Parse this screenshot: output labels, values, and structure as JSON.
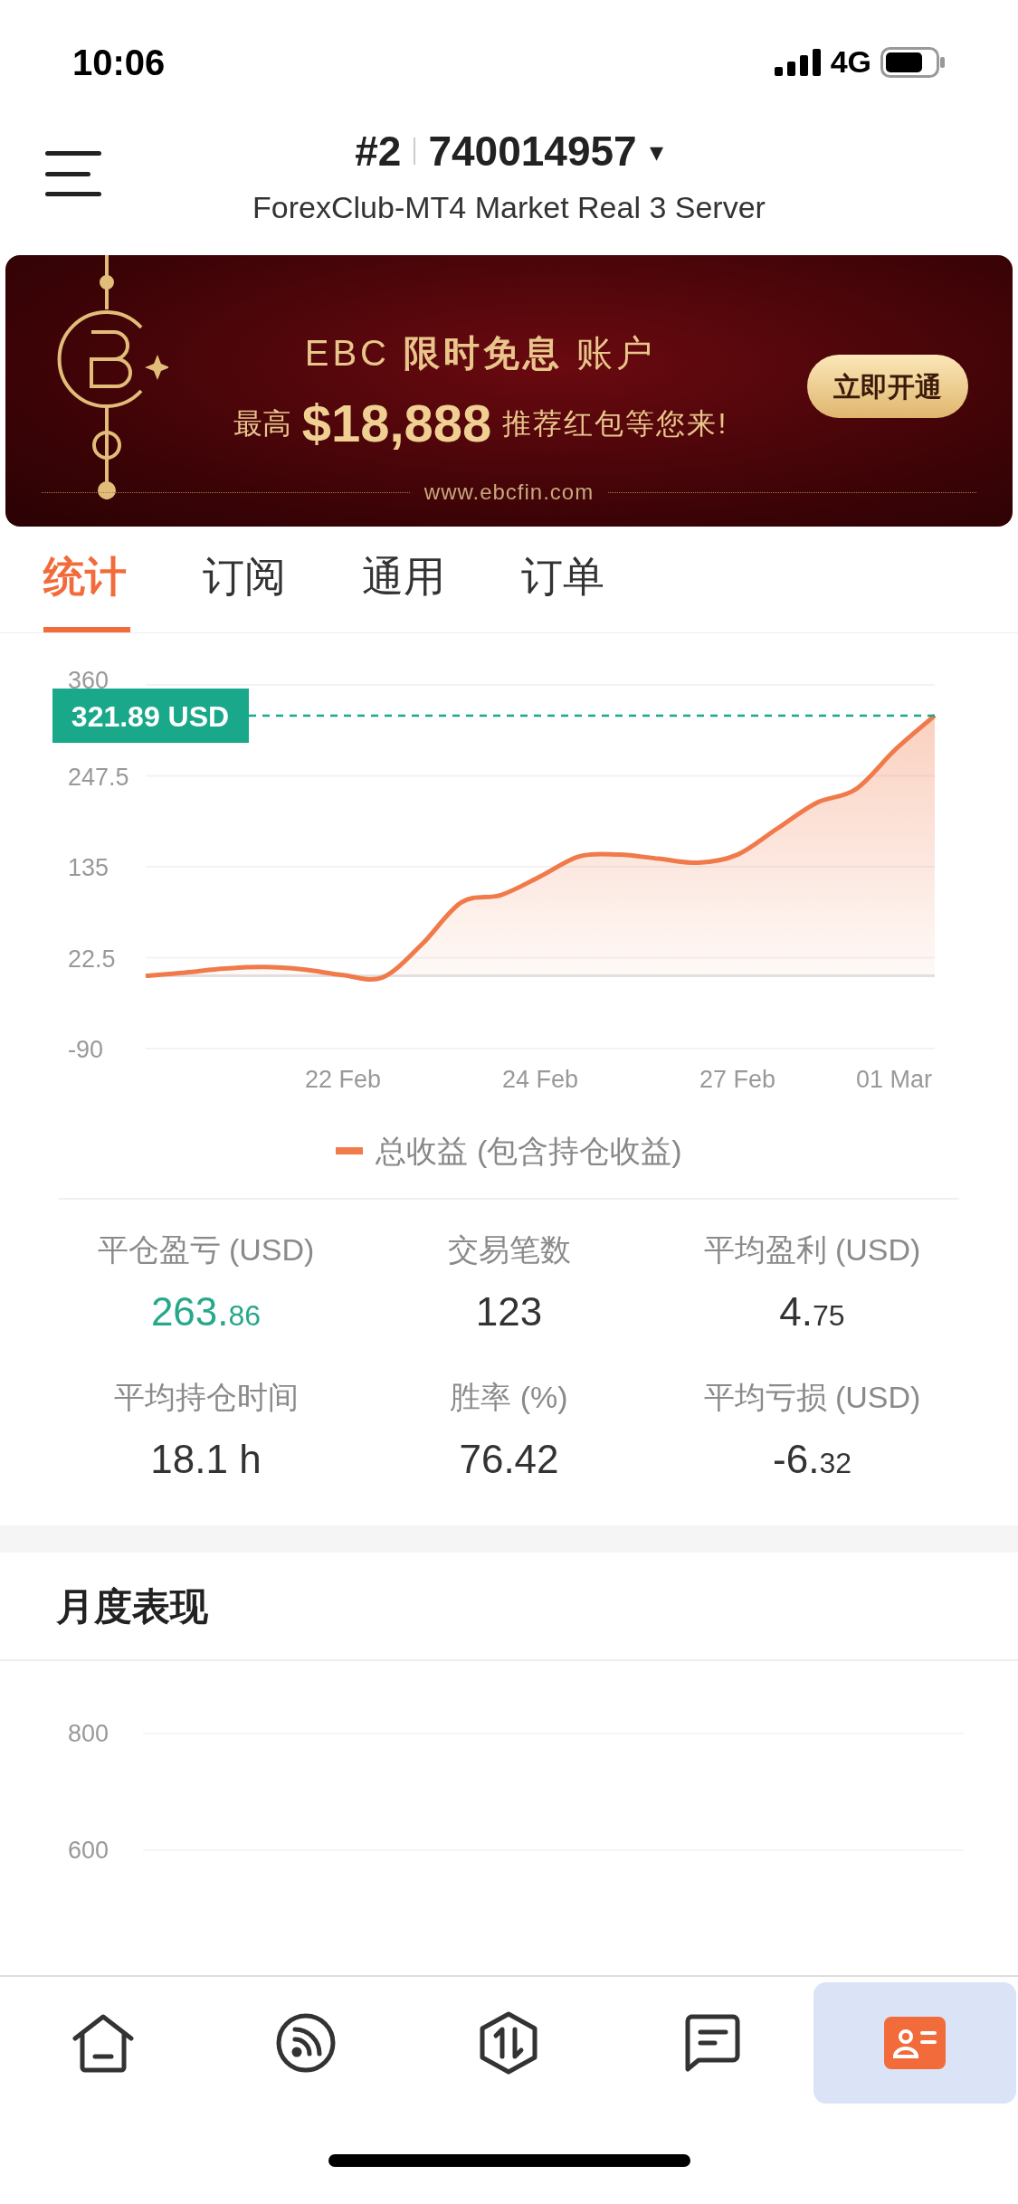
{
  "status_bar": {
    "time": "10:06",
    "network": "4G"
  },
  "header": {
    "account_number": "#2",
    "account_id": "740014957",
    "caret": "▾",
    "server": "ForexClub-MT4 Market Real 3 Server"
  },
  "banner": {
    "headline": "EBC **限时免息** 账户",
    "prefix": "最高",
    "amount": "$18,888",
    "suffix": "推荐红包等您来!",
    "button": "立即开通",
    "url": "www.ebcfin.com"
  },
  "tabs": [
    {
      "label": "统计",
      "selected": true
    },
    {
      "label": "订阅",
      "selected": false
    },
    {
      "label": "通用",
      "selected": false
    },
    {
      "label": "订单",
      "selected": false
    }
  ],
  "equity_chart": {
    "chart_data": {
      "type": "area",
      "grid": true,
      "categories": [
        null,
        null,
        null,
        null,
        null,
        "22 Feb",
        null,
        null,
        null,
        null,
        "24 Feb",
        null,
        null,
        null,
        null,
        "27 Feb",
        null,
        null,
        null,
        "01 Mar",
        null
      ],
      "series": [
        {
          "name": "总收益 (包含持仓收益)",
          "color": "#f07a4a",
          "values": [
            0,
            4,
            9,
            11,
            8,
            1,
            -2,
            39,
            91,
            100,
            123,
            148,
            150,
            145,
            140,
            150,
            182,
            214,
            231,
            280,
            322
          ]
        }
      ],
      "ylim": [
        -90,
        360
      ],
      "yticks": [
        360,
        247.5,
        135,
        22.5,
        -90
      ],
      "ref_lines": [
        {
          "axis": "y",
          "value": 321.89,
          "label": "321.89 USD"
        }
      ]
    }
  },
  "stats": [
    {
      "label": "平仓盈亏 (USD)",
      "value_main": "263.",
      "value_minor": "86",
      "color": "#26a88a"
    },
    {
      "label": "交易笔数",
      "value_main": "123",
      "color": "#333333"
    },
    {
      "label": "平均盈利 (USD)",
      "value_main": "4.",
      "value_minor": "75",
      "color": "#333333"
    },
    {
      "label": "平均持仓时间",
      "value_main": "18.1 h",
      "color": "#333333"
    },
    {
      "label": "胜率 (%)",
      "value_main": "76.42",
      "color": "#333333"
    },
    {
      "label": "平均亏损 (USD)",
      "value_main": "-6.",
      "value_minor": "32",
      "color": "#333333"
    }
  ],
  "monthly": {
    "title": "月度表现",
    "y_labels": [
      "800",
      "600"
    ]
  },
  "bottom_nav": [
    {
      "kind": "home",
      "selected": false
    },
    {
      "kind": "feed",
      "selected": false
    },
    {
      "kind": "trade",
      "selected": false
    },
    {
      "kind": "messages",
      "selected": false
    },
    {
      "kind": "profile",
      "selected": true
    }
  ]
}
